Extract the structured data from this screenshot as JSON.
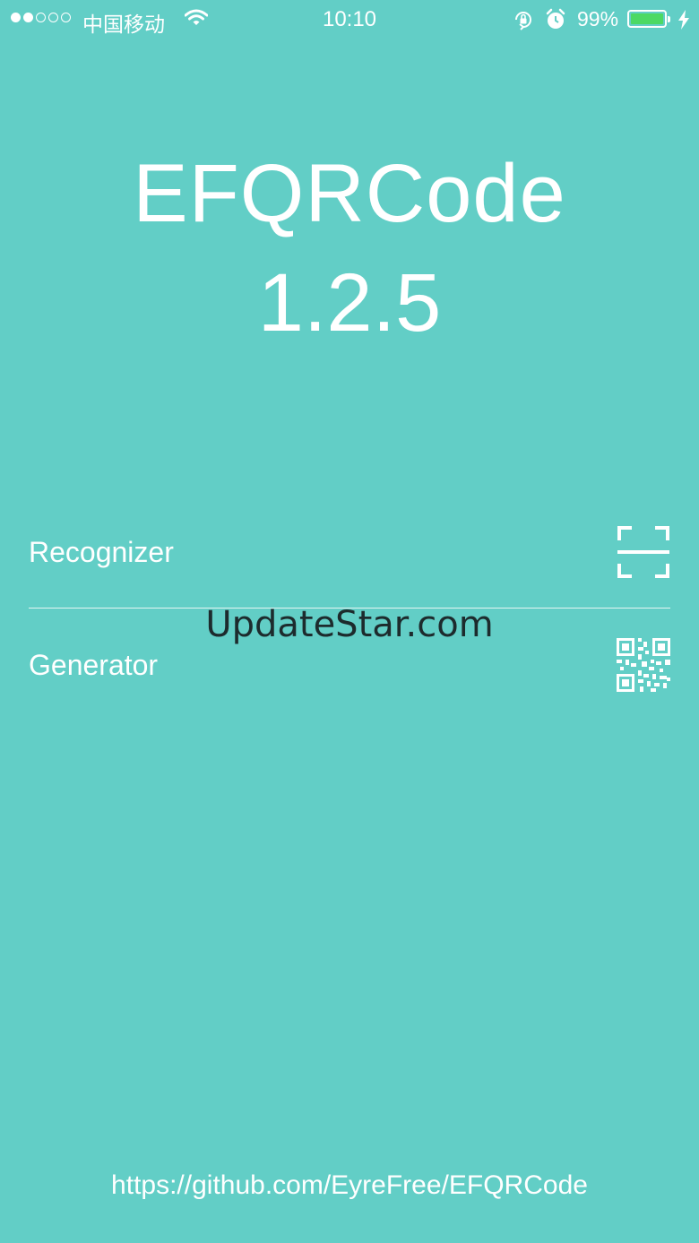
{
  "status_bar": {
    "carrier": "中国移动",
    "time": "10:10",
    "battery_percent": "99%",
    "battery_level": 0.99,
    "signal_bars_filled": 2,
    "signal_bars_total": 5,
    "icons": [
      "wifi-icon",
      "orientation-lock-icon",
      "alarm-icon",
      "battery-icon",
      "charging-bolt-icon"
    ]
  },
  "header": {
    "title": "EFQRCode",
    "version": "1.2.5"
  },
  "menu": {
    "items": [
      {
        "label": "Recognizer",
        "icon": "scan-frame-icon"
      },
      {
        "label": "Generator",
        "icon": "qr-code-icon"
      }
    ]
  },
  "watermark": "UpdateStar.com",
  "footer": {
    "link": "https://github.com/EyreFree/EFQRCode"
  },
  "colors": {
    "background": "#62cec6",
    "foreground": "#ffffff",
    "battery_fill": "#4cd964",
    "watermark": "#1d2b2d"
  }
}
